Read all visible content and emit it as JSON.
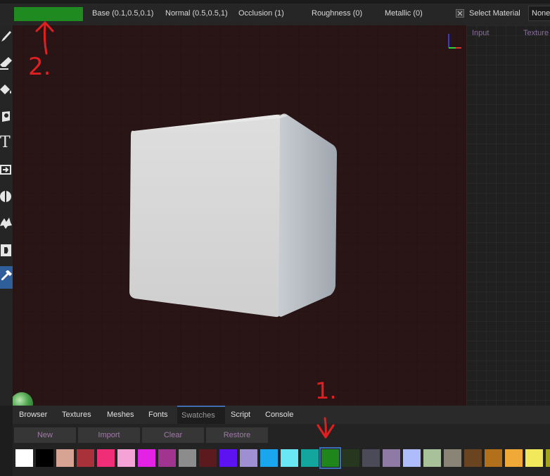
{
  "toolbar": {
    "picked_color": "#1f8a1f",
    "base": "Base (0.1,0.5,0.1)",
    "normal": "Normal (0.5,0.5,1)",
    "occlusion": "Occlusion (1)",
    "roughness": "Roughness (0)",
    "metallic": "Metallic (0)",
    "select_material_label": "Select Material",
    "select_material_value": "None"
  },
  "left_tools": [
    {
      "icon": "brush-icon"
    },
    {
      "icon": "eraser-icon"
    },
    {
      "icon": "fill-icon"
    },
    {
      "icon": "decal-icon"
    },
    {
      "icon": "text-icon",
      "glyph": "T"
    },
    {
      "icon": "clone-icon"
    },
    {
      "icon": "blur-icon"
    },
    {
      "icon": "smudge-icon"
    },
    {
      "icon": "bake-icon"
    },
    {
      "icon": "picker-icon",
      "active": true
    }
  ],
  "node_panel": {
    "input_label": "Input",
    "texture_label": "Texture"
  },
  "bottom": {
    "tabs": [
      "Browser",
      "Textures",
      "Meshes",
      "Fonts",
      "Swatches",
      "Script",
      "Console"
    ],
    "active_tab": "Swatches",
    "buttons": [
      "New",
      "Import",
      "Clear",
      "Restore"
    ],
    "swatches": [
      "#ffffff",
      "#000000",
      "#d7a393",
      "#a9323a",
      "#ef2e77",
      "#f5a3d6",
      "#e322e6",
      "#a0348f",
      "#8c8c8c",
      "#5c1a1f",
      "#5d13f1",
      "#9d8fd2",
      "#1aa6ef",
      "#6ae7f4",
      "#13a69f",
      "#1f861c",
      "#27361f",
      "#4a4a58",
      "#8e7aa4",
      "#aebcfb",
      "#a9c19b",
      "#8a8476",
      "#6a4420",
      "#b3701a",
      "#f0a837",
      "#f2e85b",
      "#a3a31a"
    ],
    "selected_swatch_index": 15
  },
  "annotations": {
    "note_1": "1.",
    "note_2": "2.",
    "color": "#e02020"
  }
}
